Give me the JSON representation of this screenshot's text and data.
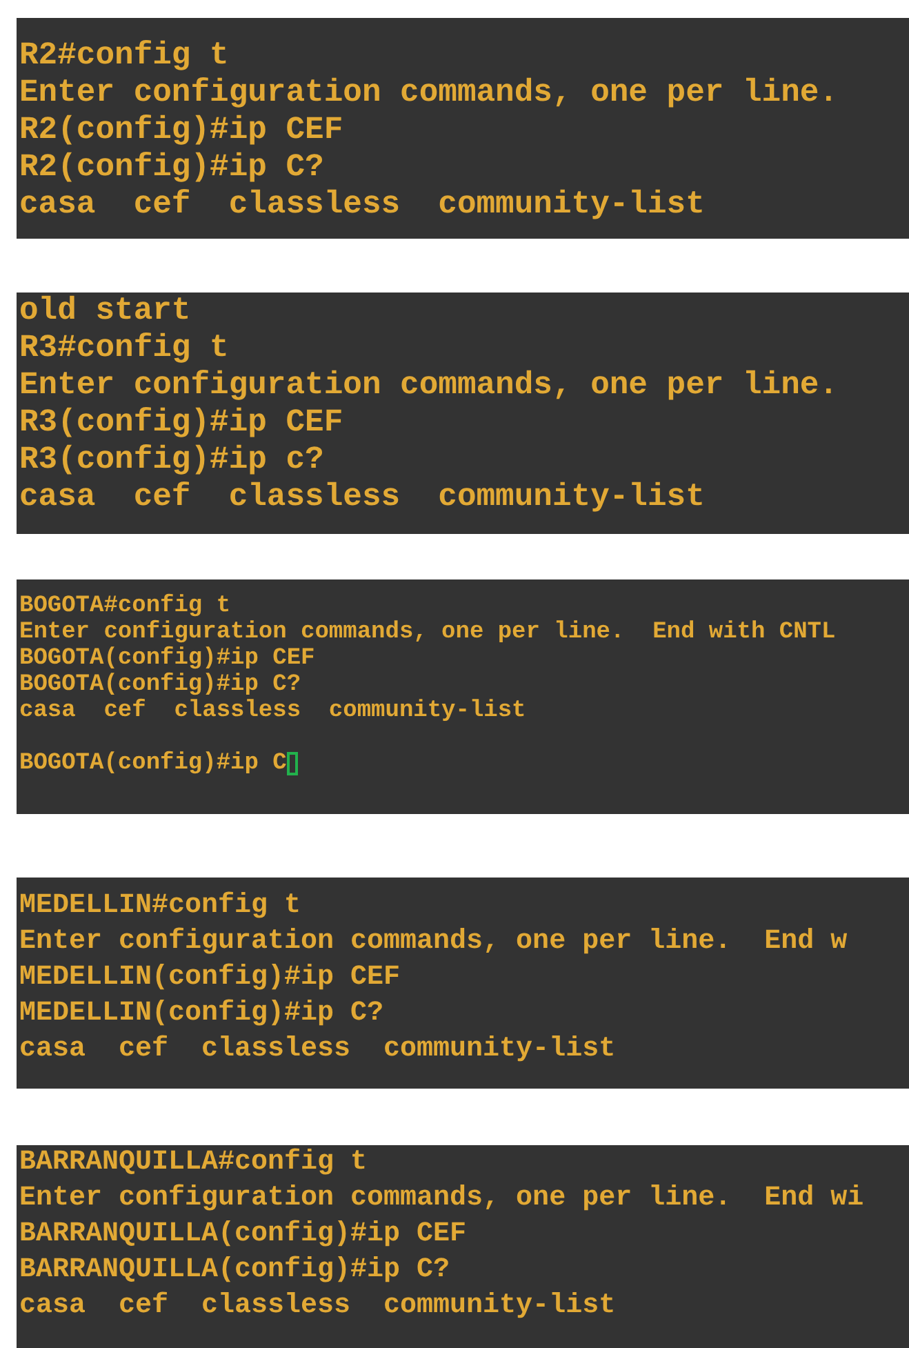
{
  "terminals": [
    {
      "lines": [
        "R2#config t",
        "Enter configuration commands, one per line.",
        "R2(config)#ip CEF",
        "R2(config)#ip C?",
        "casa  cef  classless  community-list"
      ]
    },
    {
      "lines": [
        "old start",
        "R3#config t",
        "Enter configuration commands, one per line.",
        "R3(config)#ip CEF",
        "R3(config)#ip c?",
        "casa  cef  classless  community-list"
      ]
    },
    {
      "lines": [
        "BOGOTA#config t",
        "Enter configuration commands, one per line.  End with CNTL",
        "BOGOTA(config)#ip CEF",
        "BOGOTA(config)#ip C?",
        "casa  cef  classless  community-list"
      ],
      "input_line": {
        "text": "BOGOTA(config)#ip C",
        "cursor": true
      }
    },
    {
      "lines": [
        "MEDELLIN#config t",
        "Enter configuration commands, one per line.  End w",
        "MEDELLIN(config)#ip CEF",
        "MEDELLIN(config)#ip C?",
        "casa  cef  classless  community-list"
      ]
    },
    {
      "lines": [
        "BARRANQUILLA#config t",
        "Enter configuration commands, one per line.  End wi",
        "BARRANQUILLA(config)#ip CEF",
        "BARRANQUILLA(config)#ip C?",
        "casa  cef  classless  community-list"
      ]
    }
  ]
}
